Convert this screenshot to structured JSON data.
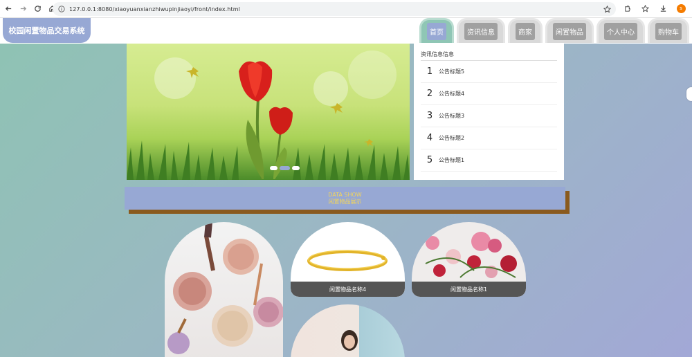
{
  "browser": {
    "url": "127.0.0.1:8080/xiaoyuanxianzhiwupinjiaoyi/front/index.html",
    "profile_initial": "s"
  },
  "site": {
    "brand": "校园闲置物品交易系统",
    "nav": [
      {
        "label": "首页",
        "active": true
      },
      {
        "label": "资讯信息",
        "active": false
      },
      {
        "label": "商家",
        "active": false
      },
      {
        "label": "闲置物品",
        "active": false
      },
      {
        "label": "个人中心",
        "active": false
      },
      {
        "label": "购物车",
        "active": false
      }
    ]
  },
  "carousel": {
    "slide_count": 3,
    "active_index": 1
  },
  "news": {
    "title": "资讯信息信息",
    "items": [
      {
        "num": "1",
        "text": "公告标题5"
      },
      {
        "num": "2",
        "text": "公告标题4"
      },
      {
        "num": "3",
        "text": "公告标题3"
      },
      {
        "num": "4",
        "text": "公告标题2"
      },
      {
        "num": "5",
        "text": "公告标题1"
      }
    ]
  },
  "data_show": {
    "en": "DATA SHOW",
    "zh": "闲置物品展示"
  },
  "products": [
    {
      "name": ""
    },
    {
      "name": "闲置物品名称4"
    },
    {
      "name": "闲置物品名称1"
    },
    {
      "name": ""
    }
  ],
  "colors": {
    "accent": "#97a8d4",
    "active_tab": "#8fc6b5",
    "banner_text": "#f3d55a"
  }
}
